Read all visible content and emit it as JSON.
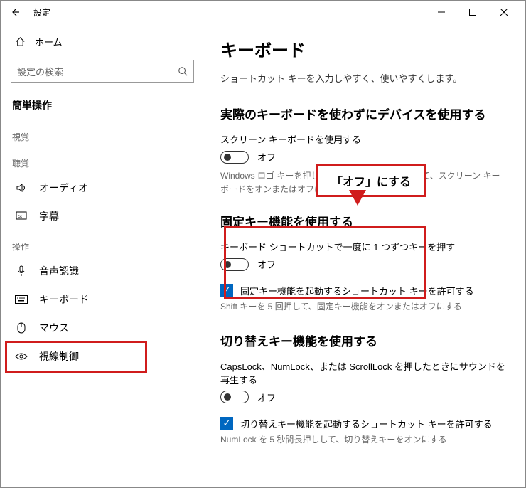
{
  "titlebar": {
    "app_title": "設定"
  },
  "sidebar": {
    "home": "ホーム",
    "search_placeholder": "設定の検索",
    "category": "簡単操作",
    "groups": [
      {
        "label": "視覚",
        "items": []
      },
      {
        "label": "聴覚",
        "items": [
          {
            "icon": "audio",
            "label": "オーディオ"
          },
          {
            "icon": "cc",
            "label": "字幕"
          }
        ]
      },
      {
        "label": "操作",
        "items": [
          {
            "icon": "mic",
            "label": "音声認識"
          },
          {
            "icon": "keyboard",
            "label": "キーボード",
            "selected": true
          },
          {
            "icon": "mouse",
            "label": "マウス"
          },
          {
            "icon": "eye",
            "label": "視線制御"
          }
        ]
      }
    ]
  },
  "content": {
    "title": "キーボード",
    "subtitle": "ショートカット キーを入力しやすく、使いやすくします。",
    "sections": [
      {
        "heading": "実際のキーボードを使わずにデバイスを使用する",
        "option": "スクリーン キーボードを使用する",
        "toggle_state": "オフ",
        "hint": "Windows ロゴ キーを押しながら Ctrl + O キーを押して、スクリーン キーボードをオンまたはオフにします。"
      },
      {
        "heading": "固定キー機能を使用する",
        "option": "キーボード ショートカットで一度に 1 つずつキーを押す",
        "toggle_state": "オフ",
        "check_label": "固定キー機能を起動するショートカット キーを許可する",
        "check_hint": "Shift キーを 5 回押して、固定キー機能をオンまたはオフにする"
      },
      {
        "heading": "切り替えキー機能を使用する",
        "option": "CapsLock、NumLock、または ScrollLock を押したときにサウンドを再生する",
        "toggle_state": "オフ",
        "check_label": "切り替えキー機能を起動するショートカット キーを許可する",
        "check_hint": "NumLock を 5 秒間長押しして、切り替えキーをオンにする"
      }
    ]
  },
  "annotations": {
    "callout_text": "「オフ」にする"
  }
}
